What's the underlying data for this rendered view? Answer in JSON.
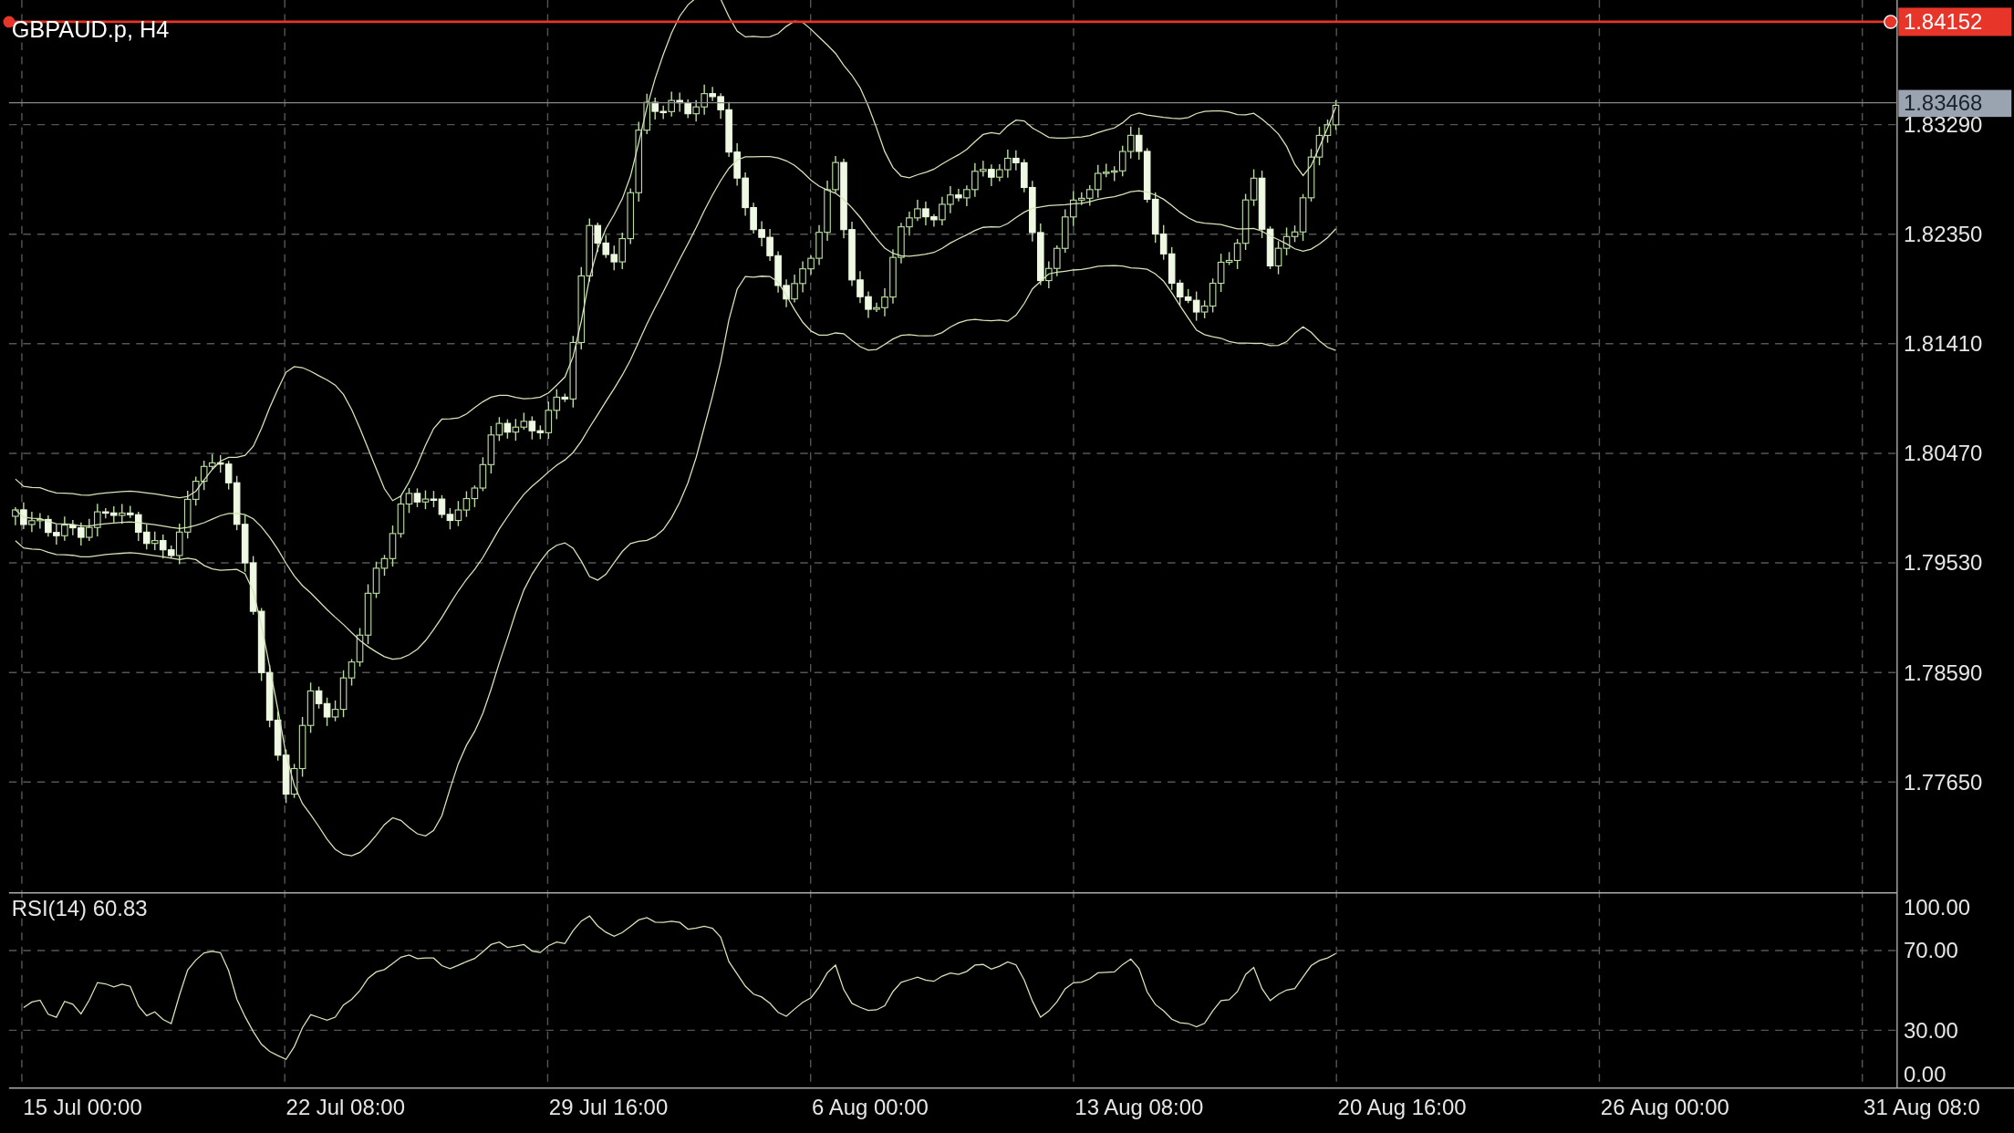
{
  "chart": {
    "title": "GBPAUD.p, H4"
  },
  "price_line": {
    "label": "1.84152"
  },
  "bid_price": "1.83468",
  "price_axis": [
    "1.83290",
    "1.82350",
    "1.81410",
    "1.80470",
    "1.79530",
    "1.78590",
    "1.77650"
  ],
  "rsi_panel": {
    "title": "RSI(14) 60.83",
    "axis": [
      "100.00",
      "70.00",
      "30.00",
      "0.00"
    ]
  },
  "time_axis": [
    "15 Jul 00:00",
    "22 Jul 08:00",
    "29 Jul 16:00",
    "6 Aug 00:00",
    "13 Aug 08:00",
    "20 Aug 16:00",
    "26 Aug 00:00",
    "31 Aug 08:0"
  ]
}
